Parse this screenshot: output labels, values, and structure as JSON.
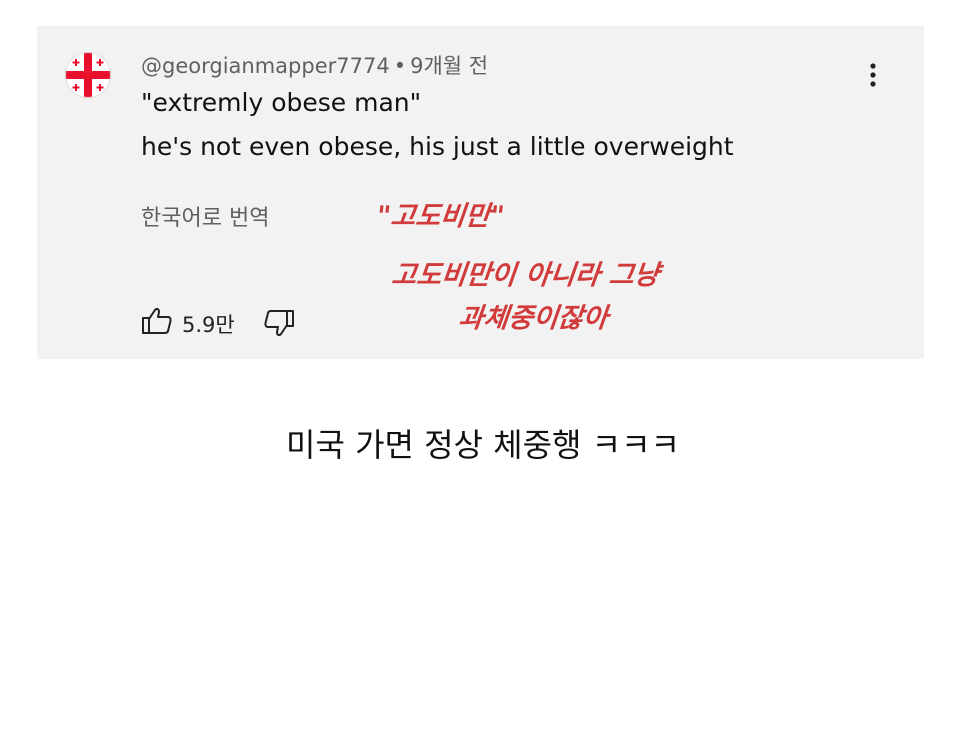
{
  "comment": {
    "author": "@georgianmapper7774",
    "separator": "•",
    "time_ago": "9개월 전",
    "text_line1": "\"extremly obese man\"",
    "text_line2": "he's not even obese, his just a little overweight",
    "translate_label": "한국어로 번역",
    "like_count": "5.9만",
    "avatar_icon": "georgia-flag-icon",
    "menu_icon": "more-vert-icon"
  },
  "annotation": {
    "line1": "\"고도비만\"",
    "line2": "고도비만이 아니라 그냥",
    "line3": "과체중이잖아",
    "color": "#d13b3b"
  },
  "caption": "미국 가면 정상 체중행 ㅋㅋㅋ",
  "colors": {
    "card_background": "#f2f2f2",
    "meta_text": "#606060",
    "flag_red": "#e8112d"
  }
}
